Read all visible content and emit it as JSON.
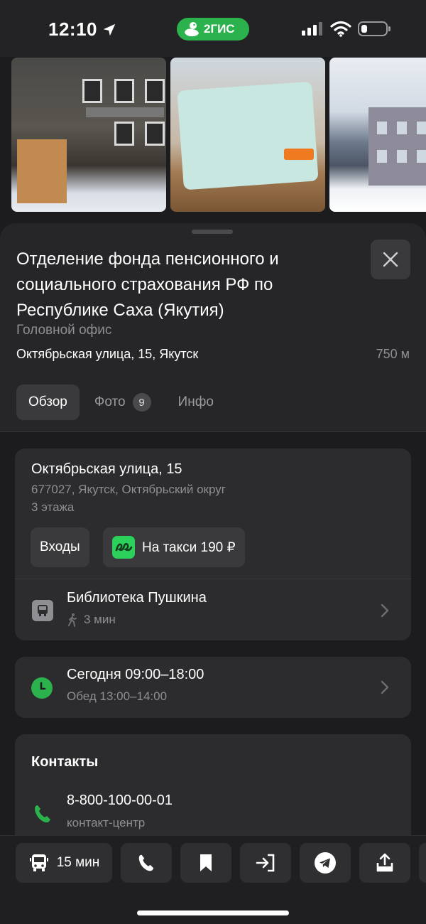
{
  "status_bar": {
    "time": "12:10",
    "app_badge": "2ГИС"
  },
  "place": {
    "title": "Отделение фонда пенсионного и социального страхования РФ по Республике Саха (Якутия)",
    "subtitle": "Головной офис",
    "address": "Октябрьская улица, 15, Якутск",
    "distance": "750 м"
  },
  "tabs": [
    {
      "label": "Обзор",
      "active": true
    },
    {
      "label": "Фото",
      "badge": "9"
    },
    {
      "label": "Инфо"
    }
  ],
  "address_card": {
    "street": "Октябрьская улица, 15",
    "postal": "677027, Якутск, Октябрьский округ",
    "floors": "3 этажа",
    "entrances_label": "Входы",
    "taxi_label": "На такси 190 ₽",
    "stop_name": "Библиотека Пушкина",
    "stop_walk": "3 мин"
  },
  "hours_card": {
    "today": "Сегодня 09:00–18:00",
    "lunch": "Обед 13:00–14:00",
    "status_color": "#2bb24c"
  },
  "contacts": {
    "title": "Контакты",
    "phone": "8-800-100-00-01",
    "phone_note": "контакт-центр"
  },
  "bottom_bar": {
    "route_label": "15 мин",
    "icons": [
      "bus-icon",
      "phone-icon",
      "bookmark-icon",
      "enter-icon",
      "telegram-icon",
      "share-icon"
    ]
  },
  "colors": {
    "accent": "#2bb24c",
    "background": "#1c1c1e",
    "card": "#2c2c2e"
  }
}
